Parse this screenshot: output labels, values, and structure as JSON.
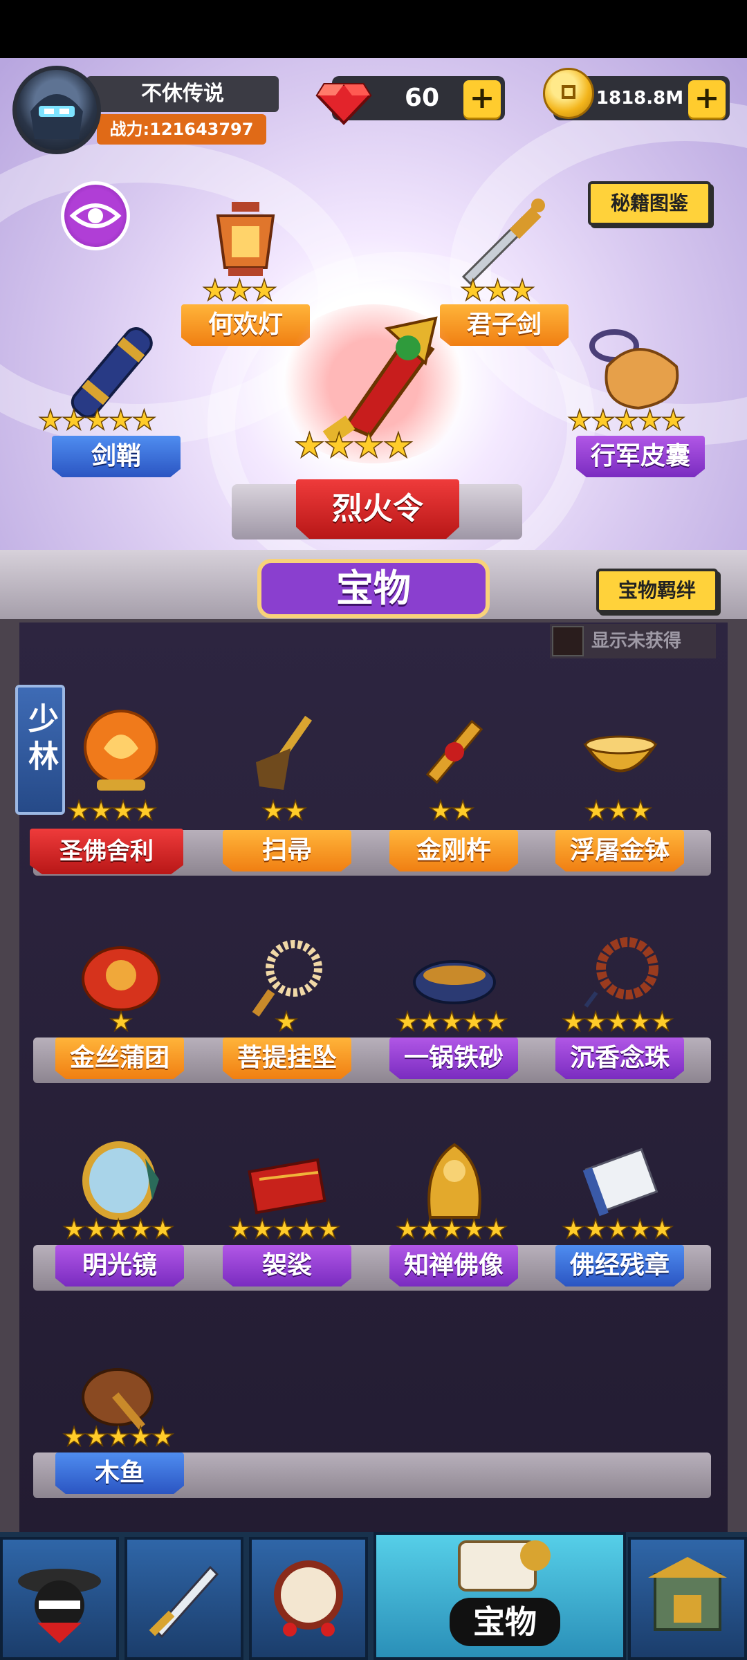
{
  "player": {
    "name": "不休传说",
    "power": "战力:121643797"
  },
  "currency": {
    "gems": "60",
    "coins": "1818.8M",
    "plus": "+"
  },
  "top_buttons": {
    "secret_manual": "秘籍图鉴",
    "treasure_bond": "宝物羁绊"
  },
  "equipped": [
    {
      "name": "何欢灯",
      "stars": 3,
      "style": "orange"
    },
    {
      "name": "君子剑",
      "stars": 3,
      "style": "orange"
    },
    {
      "name": "剑鞘",
      "stars": 5,
      "style": "blue"
    },
    {
      "name": "行军皮囊",
      "stars": 5,
      "style": "purple"
    },
    {
      "name": "烈火令",
      "stars": 4,
      "style": "red"
    }
  ],
  "tab_title": "宝物",
  "filter": {
    "show_unobtained": "显示未获得"
  },
  "category": "少林",
  "treasures": [
    {
      "name": "圣佛舍利",
      "stars": 4,
      "style": "red"
    },
    {
      "name": "扫帚",
      "stars": 2,
      "style": "orange"
    },
    {
      "name": "金刚杵",
      "stars": 2,
      "style": "orange"
    },
    {
      "name": "浮屠金钵",
      "stars": 3,
      "style": "orange"
    },
    {
      "name": "金丝蒲团",
      "stars": 1,
      "style": "orange"
    },
    {
      "name": "菩提挂坠",
      "stars": 1,
      "style": "orange"
    },
    {
      "name": "一锅铁砂",
      "stars": 5,
      "style": "purple"
    },
    {
      "name": "沉香念珠",
      "stars": 5,
      "style": "purple"
    },
    {
      "name": "明光镜",
      "stars": 5,
      "style": "purple"
    },
    {
      "name": "袈裟",
      "stars": 5,
      "style": "purple"
    },
    {
      "name": "知禅佛像",
      "stars": 5,
      "style": "purple"
    },
    {
      "name": "佛经残章",
      "stars": 5,
      "style": "blue"
    },
    {
      "name": "木鱼",
      "stars": 5,
      "style": "blue"
    }
  ],
  "bottom_nav": [
    {
      "icon": "hero-icon"
    },
    {
      "icon": "sword-icon"
    },
    {
      "icon": "drum-icon"
    },
    {
      "icon": "treasure-scroll-icon",
      "label": "宝物",
      "active": true
    },
    {
      "icon": "gate-icon"
    }
  ]
}
